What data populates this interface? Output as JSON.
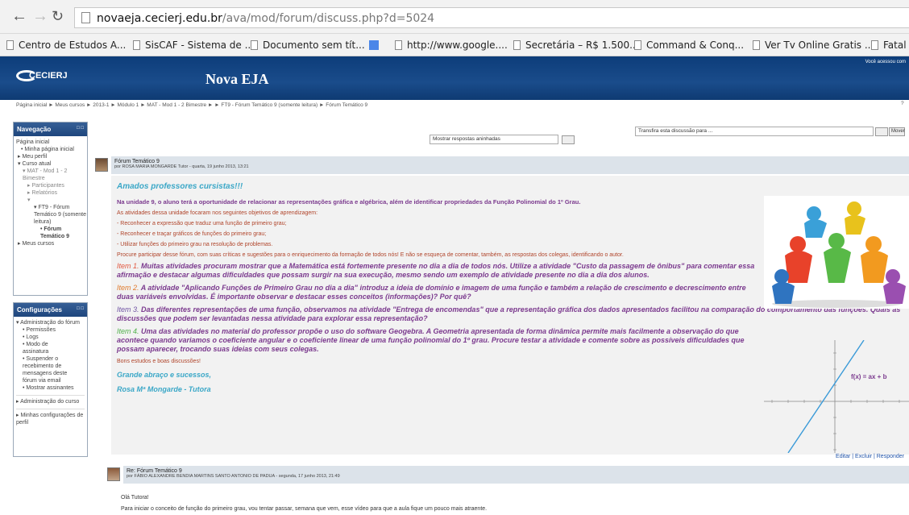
{
  "browser": {
    "url_host": "novaeja.cecierj.edu.br",
    "url_path": "/ava/mod/forum/discuss.php?d=5024",
    "bookmarks": [
      "Centro de Estudos A...",
      "SisCAF - Sistema de ...",
      "Documento sem tít...",
      "http://www.google....",
      "Secretária – R$ 1.500...",
      "Command & Conq...",
      "Ver Tv Online Gratis ...",
      "Fatal"
    ]
  },
  "header": {
    "logo": "CECIERJ",
    "logo_sub": "Fundação CECIERJ / Consórcio Cederj",
    "site_title": "Nova EJA",
    "you_accessed": "Você acessou com"
  },
  "breadcrumb": "Página inicial ► Meus cursos ► 2013-1 ► Módulo 1 ► MAT - Mod 1 - 2 Bimestre ► ► FT9 - Fórum Temático 9 (somente leitura) ► Fórum Temático 9",
  "navigation": {
    "title": "Navegação",
    "items": [
      "Página inicial",
      "Minha página inicial",
      "Meu perfil",
      "Curso atual",
      "MAT - Mod 1 - 2 Bimestre",
      "Participantes",
      "Relatórios",
      "FT9 - Fórum Temático 9 (somente leitura)",
      "Fórum Temático 9",
      "Meus cursos"
    ]
  },
  "settings": {
    "title": "Configurações",
    "items": [
      "Administração do fórum",
      "Permissões",
      "Logs",
      "Modo de assinatura",
      "Suspender o recebimento de mensagens deste fórum via email",
      "Mostrar assinantes",
      "Administração do curso",
      "Minhas configurações de perfil"
    ]
  },
  "controls": {
    "display_mode": "Mostrar respostas aninhadas",
    "move_discussion": "Transfira esta discussão para ...",
    "move_button": "Mover"
  },
  "post1": {
    "title": "Fórum Temático 9",
    "by": "por ROSA MARIA MONGARDE Tutor - quarta, 19 junho 2013, 13:21",
    "greeting": "Amados professores cursistas!!!",
    "intro": "Na unidade 9, o aluno terá a oportunidade de relacionar as representações gráfica e algébrica, além de identificar propriedades da Função Polinomial do 1º Grau.",
    "objectives": "As atividades dessa unidade focaram nos seguintes objetivos de aprendizagem:",
    "obj1": "- Reconhecer a expressão que traduz uma função de primeiro grau;",
    "obj2": "- Reconhecer e traçar gráficos de funções do primeiro grau;",
    "obj3": "- Utilizar funções do primeiro grau na resolução de problemas.",
    "invite": "Procure participar desse fórum, com suas críticas e sugestões para o enriquecimento da formação de todos nós! E não se esqueça de comentar, também, as respostas dos colegas, identificando o autor.",
    "item1_tag": "Item 1.",
    "item1": "Muitas atividades procuram mostrar que a Matemática está fortemente presente no dia a dia de todos nós. Utilize a atividade \"Custo da passagem de ônibus\" para comentar essa afirmação e destacar algumas dificuldades que possam surgir na sua execução, mesmo sendo um exemplo de atividade presente no dia a dia dos alunos.",
    "item2_tag": "Item 2.",
    "item2": "A atividade \"Aplicando Funções de Primeiro Grau no dia a dia\" introduz a ideia de domínio e imagem de uma função e também a relação de crescimento e decrescimento entre duas variáveis envolvidas. É importante observar e destacar esses conceitos (informações)? Por quê?",
    "item3_tag": "Item 3.",
    "item3": "Das diferentes representações de uma função, observamos na atividade \"Entrega de encomendas\" que a representação gráfica dos dados apresentados facilitou na comparação do comportamento das funções. Quais as discussões que podem ser levantadas nessa atividade para explorar essa representação?",
    "item4_tag": "Item 4.",
    "item4": "Uma das atividades no material do professor propõe o uso do software Geogebra.  A Geometria apresentada de forma dinâmica permite mais facilmente a observação do que acontece quando variamos o coeficiente angular e o coeficiente linear de uma função polinomial do 1º grau. Procure testar a atividade e comente sobre as possíveis dificuldades que possam aparecer, trocando suas ideias com seus colegas.",
    "closing": "Bons estudos e boas discussões!",
    "hug": "Grande abraço e sucessos,",
    "signature": "Rosa Mª Mongarde - Tutora",
    "formula": "f(x) = ax + b",
    "actions": "Editar | Excluir | Responder"
  },
  "post2": {
    "title": "Re: Fórum Temático 9",
    "by": "por FÁBIO ALEXANDRE BENDIA MARTINS SANTO ANTONIO DE PADUA - segunda, 17 junho 2013, 21:49",
    "line1": "Olá Tutora!",
    "line2": "Para iniciar o conceito de função do primeiro grau, vou tentar passar, semana que vem, esse vídeo para que a aula fique um pouco mais atraente."
  }
}
